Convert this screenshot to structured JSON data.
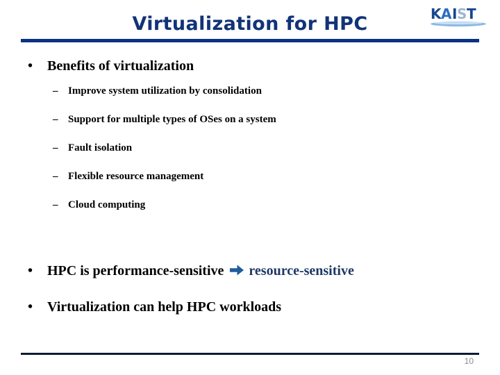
{
  "slide": {
    "title": "Virtualization for HPC",
    "page_number": "10",
    "colors": {
      "title_blue": "#113377",
      "rule_blue": "#0a3183",
      "footer_rule": "#0d1b33",
      "accent_navy": "#1f3864",
      "logo_blue": "#1e5bb0",
      "logo_dark_blue": "#17478f",
      "logo_swoosh": "#7fb3e3",
      "page_number_gray": "#8a8a8a",
      "body_text": "#000000"
    }
  },
  "logo": {
    "name": "KAIST",
    "text": "KAIST"
  },
  "bullets": [
    {
      "level": 1,
      "marker": "•",
      "text": "Benefits of virtualization"
    }
  ],
  "sub_bullets": [
    {
      "marker": "–",
      "text": "Improve system utilization by consolidation"
    },
    {
      "marker": "–",
      "text": "Support for multiple types of OSes on a system"
    },
    {
      "marker": "–",
      "text": "Fault isolation"
    },
    {
      "marker": "–",
      "text": "Flexible resource management"
    },
    {
      "marker": "–",
      "text": "Cloud computing"
    }
  ],
  "conclusion": {
    "marker": "•",
    "lead_text": "HPC is performance-sensitive",
    "arrow_icon": "right-block-arrow",
    "accent_text": "resource-sensitive"
  },
  "final_bullet": {
    "marker": "•",
    "text": "Virtualization can help HPC workloads"
  }
}
